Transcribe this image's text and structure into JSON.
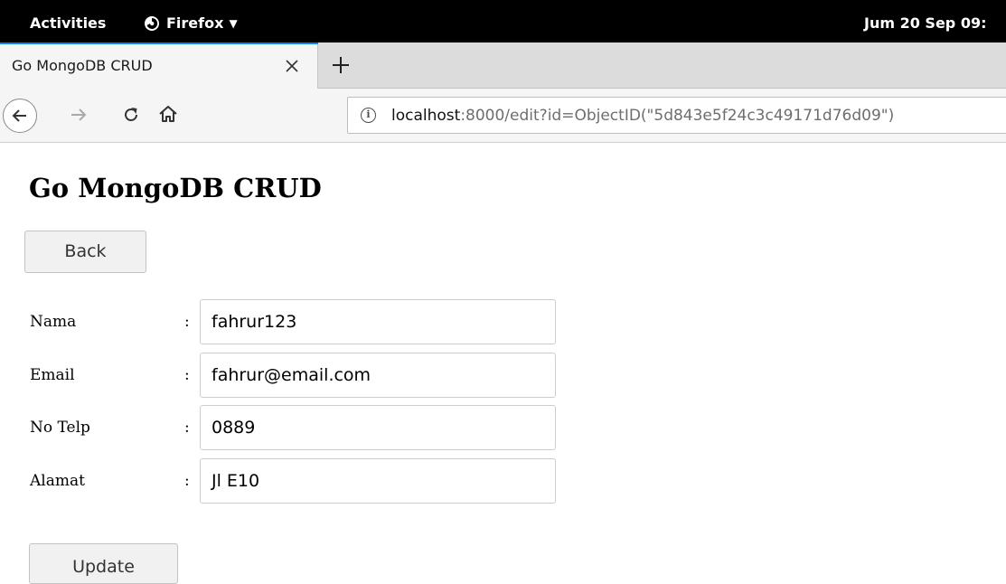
{
  "topbar": {
    "activities_label": "Activities",
    "app_name": "Firefox",
    "clock": "Jum 20 Sep 09:"
  },
  "browser": {
    "tab_title": "Go MongoDB CRUD",
    "url_host": "localhost",
    "url_rest": ":8000/edit?id=ObjectID(\"5d843e5f24c3c49171d76d09\")",
    "accent_color": "#0a84ff"
  },
  "page": {
    "title": "Go MongoDB CRUD",
    "back_label": "Back",
    "update_label": "Update",
    "separator": ":",
    "fields": [
      {
        "label": "Nama",
        "value": "fahrur123"
      },
      {
        "label": "Email",
        "value": "fahrur@email.com"
      },
      {
        "label": "No Telp",
        "value": "0889"
      },
      {
        "label": "Alamat",
        "value": "Jl E10"
      }
    ]
  }
}
